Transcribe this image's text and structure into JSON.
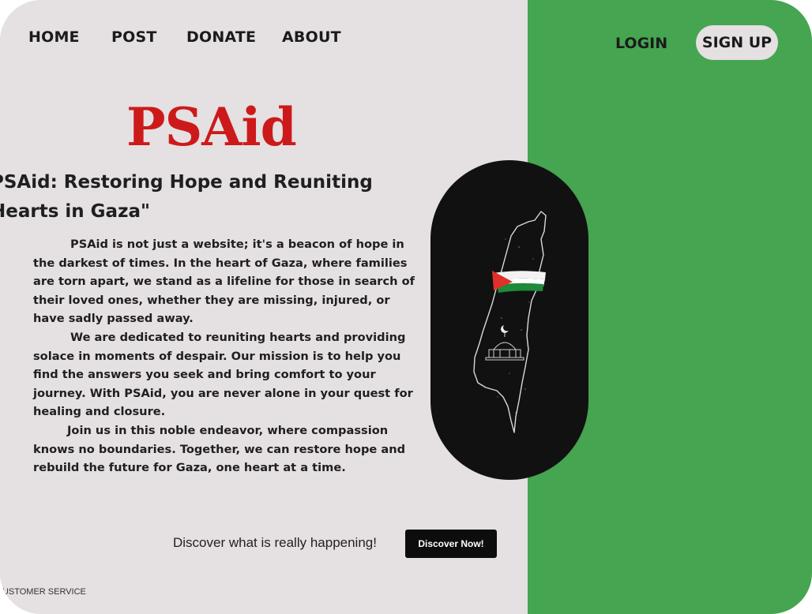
{
  "nav": {
    "items": [
      {
        "label": "HOME"
      },
      {
        "label": "POST"
      },
      {
        "label": "DONATE"
      },
      {
        "label": "ABOUT"
      }
    ],
    "login_label": "LOGIN",
    "signup_label": "SIGN UP"
  },
  "brand": {
    "logo_text": "PSAid",
    "logo_color": "#cc1a1a"
  },
  "hero": {
    "headline": "PSAid: Restoring Hope and Reuniting Hearts in Gaza\"",
    "paragraphs": [
      "PSAid is not just a website; it's a beacon of hope in the darkest of times. In the heart of Gaza, where families are torn apart, we stand as a lifeline for those in search of their loved ones, whether they are missing, injured, or have sadly passed away.",
      "We are dedicated to reuniting hearts and providing solace in moments of despair. Our mission is to help you find the answers you seek and bring comfort to your journey. With PSAid, you are never alone in your quest for healing and closure.",
      "Join us in this noble endeavor, where compassion knows no boundaries. Together, we can restore hope and rebuild the future for Gaza, one heart at a time."
    ],
    "image_icon": "palestine-map-flag-icon"
  },
  "cta": {
    "text": "Discover what is really happening!",
    "button_label": "Discover Now!"
  },
  "footer": {
    "customer_service": "CUSTOMER SERVICE"
  },
  "colors": {
    "left_background": "#e5e0e1",
    "right_background": "#45a550",
    "flag_red": "#e0302b",
    "flag_green": "#1e8a3a"
  }
}
